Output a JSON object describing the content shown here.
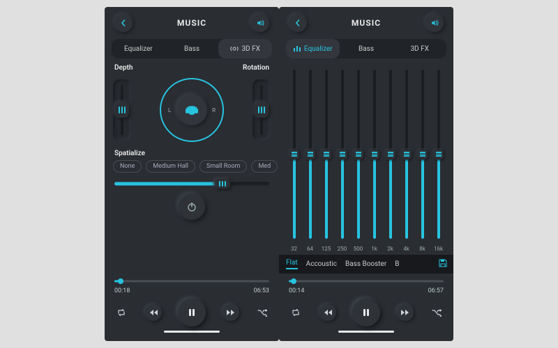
{
  "colors": {
    "accent": "#27c4e0",
    "bg": "#2a2d32"
  },
  "tabs": [
    {
      "label": "Equalizer"
    },
    {
      "label": "Bass"
    },
    {
      "label": "3D FX"
    }
  ],
  "left": {
    "header_title": "MUSIC",
    "active_tab": 2,
    "depth_label": "Depth",
    "rotation_label": "Rotation",
    "depth_value_pct": 50,
    "rotation_value_pct": 50,
    "lr": {
      "l": "L",
      "r": "R"
    },
    "spatialize_label": "Spatialize",
    "spatialize_options": [
      "None",
      "Medium Hall",
      "Small Room",
      "Med"
    ],
    "spatialize_slider_pct": 70,
    "player": {
      "elapsed": "00:18",
      "duration": "06:53",
      "progress_pct": 4
    }
  },
  "right": {
    "header_title": "MUSIC",
    "active_tab": 0,
    "eq_freqs": [
      "32",
      "64",
      "125",
      "250",
      "500",
      "1k",
      "2k",
      "4k",
      "8k",
      "16k"
    ],
    "eq_values_pct": [
      50,
      50,
      50,
      50,
      50,
      50,
      50,
      50,
      50,
      50
    ],
    "presets": [
      "Flat",
      "Accoustic",
      "Bass Booster",
      "B"
    ],
    "presets_active": 0,
    "player": {
      "elapsed": "00:14",
      "duration": "06:57",
      "progress_pct": 3
    }
  }
}
